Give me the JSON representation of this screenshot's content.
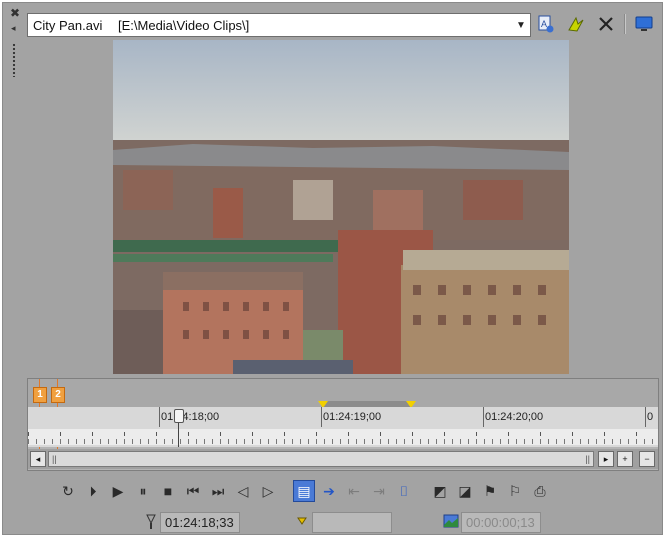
{
  "window": {
    "close_glyph": "✖",
    "pin_glyph": "◂"
  },
  "source": {
    "file_name": "City Pan.avi",
    "file_path": "[E:\\Media\\Video Clips\\]",
    "dropdown_glyph": "▼"
  },
  "toolbar_icons": [
    "properties-icon",
    "effects-icon",
    "clear-icon",
    "external-monitor-icon"
  ],
  "timeline": {
    "markers": [
      {
        "label": "1"
      },
      {
        "label": "2"
      }
    ],
    "timecodes": [
      "01:24:18;00",
      "01:24:19;00",
      "01:24:20;00",
      "0"
    ],
    "playhead_glyph": "",
    "scroll_thumb_left": "||",
    "scroll_thumb_right": "||",
    "scroll_left_glyph": "◂",
    "scroll_right_glyph": "▸",
    "zoom_in_glyph": "+",
    "zoom_out_glyph": "−"
  },
  "transport": [
    {
      "name": "loop-playback-button",
      "glyph": "↻",
      "state": "normal"
    },
    {
      "name": "play-from-start-button",
      "glyph": "⏵",
      "state": "normal"
    },
    {
      "name": "play-button",
      "glyph": "▶",
      "state": "normal"
    },
    {
      "name": "pause-button",
      "glyph": "⏸",
      "state": "normal"
    },
    {
      "name": "stop-button",
      "glyph": "■",
      "state": "normal"
    },
    {
      "name": "go-to-start-button",
      "glyph": "⏮",
      "state": "normal"
    },
    {
      "name": "go-to-end-button",
      "glyph": "⏭",
      "state": "normal"
    },
    {
      "name": "previous-frame-button",
      "glyph": "◁",
      "state": "normal"
    },
    {
      "name": "next-frame-button",
      "glyph": "▷",
      "state": "normal"
    },
    {
      "name": "gap",
      "glyph": "",
      "state": "gap"
    },
    {
      "name": "overwrite-button",
      "glyph": "▤",
      "state": "active"
    },
    {
      "name": "add-to-timeline-button",
      "glyph": "➔",
      "state": "blue"
    },
    {
      "name": "insert-before-button",
      "glyph": "⇤",
      "state": "disabled"
    },
    {
      "name": "insert-after-button",
      "glyph": "⇥",
      "state": "disabled"
    },
    {
      "name": "snap-button",
      "glyph": "⌷",
      "state": "blue"
    },
    {
      "name": "gap",
      "glyph": "",
      "state": "gap"
    },
    {
      "name": "create-subclip-button",
      "glyph": "◩",
      "state": "normal"
    },
    {
      "name": "selection-button",
      "glyph": "◪",
      "state": "normal"
    },
    {
      "name": "insert-marker-button",
      "glyph": "⚑",
      "state": "normal"
    },
    {
      "name": "insert-region-button",
      "glyph": "⚐",
      "state": "normal"
    },
    {
      "name": "export-button",
      "glyph": "⎙",
      "state": "normal"
    }
  ],
  "status": {
    "cursor_time": "01:24:18;33",
    "selection_start": "",
    "selection_length": "00:00:00;13"
  },
  "colors": {
    "panel_bg": "#a3a3a3",
    "marker": "#f0a040",
    "loop": "#f2d000",
    "active_button": "#4a7ad6"
  }
}
